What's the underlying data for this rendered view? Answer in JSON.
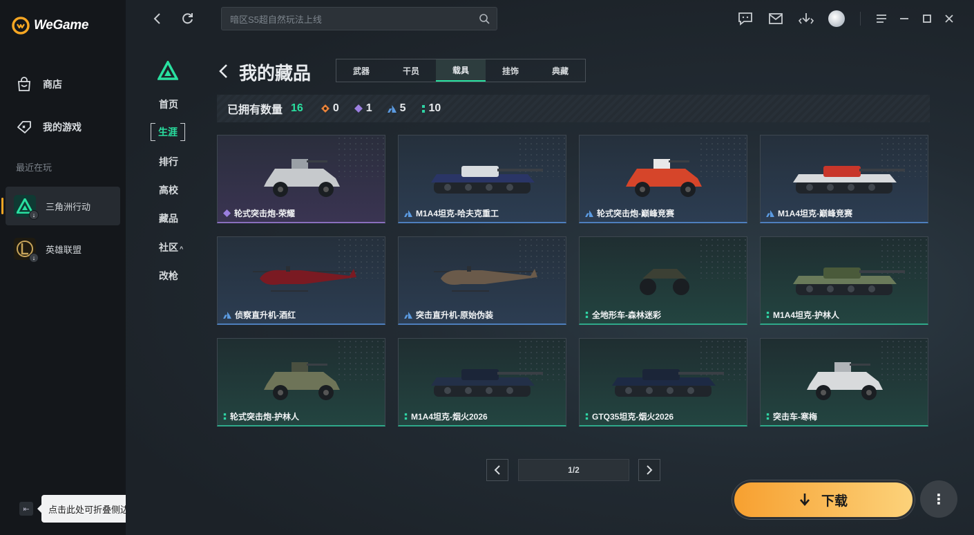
{
  "app": {
    "name": "WeGame"
  },
  "sidebar": {
    "items": [
      {
        "label": "商店",
        "icon": "shop-bag-icon"
      },
      {
        "label": "我的游戏",
        "icon": "gamepad-icon"
      }
    ],
    "recent_label": "最近在玩",
    "games": [
      {
        "label": "三角洲行动",
        "icon": "delta-force-icon",
        "active": true
      },
      {
        "label": "英雄联盟",
        "icon": "league-icon",
        "active": false
      }
    ],
    "collapse_tooltip": "点击此处可折叠侧边栏"
  },
  "topbar": {
    "search_placeholder": "暗区S5超自然玩法上线"
  },
  "subnav": {
    "items": [
      "首页",
      "生涯",
      "排行",
      "高校",
      "藏品",
      "社区",
      "改枪"
    ],
    "active": "生涯"
  },
  "page": {
    "title": "我的藏品",
    "tabs": [
      "武器",
      "干员",
      "载具",
      "挂饰",
      "典藏"
    ],
    "active_tab": "载具"
  },
  "stats": {
    "owned_label": "已拥有数量",
    "owned_total": "16",
    "counts": [
      {
        "rarity": "orange",
        "color": "#e8823a",
        "value": "0"
      },
      {
        "rarity": "purple",
        "color": "#9b7fe0",
        "value": "1"
      },
      {
        "rarity": "blue",
        "color": "#5b9ae0",
        "value": "5"
      },
      {
        "rarity": "green",
        "color": "#2fd4a4",
        "value": "10"
      }
    ]
  },
  "items": [
    {
      "name": "轮式突击炮-荣耀",
      "rarity": "purple"
    },
    {
      "name": "M1A4坦克-哈夫克重工",
      "rarity": "blue"
    },
    {
      "name": "轮式突击炮-巅峰竞赛",
      "rarity": "blue"
    },
    {
      "name": "M1A4坦克-巅峰竞赛",
      "rarity": "blue"
    },
    {
      "name": "侦察直升机-酒红",
      "rarity": "blue"
    },
    {
      "name": "突击直升机-原始伪装",
      "rarity": "blue"
    },
    {
      "name": "全地形车-森林迷彩",
      "rarity": "green"
    },
    {
      "name": "M1A4坦克-护林人",
      "rarity": "green"
    },
    {
      "name": "轮式突击炮-护林人",
      "rarity": "green"
    },
    {
      "name": "M1A4坦克-烟火2026",
      "rarity": "green"
    },
    {
      "name": "GTQ35坦克-烟火2026",
      "rarity": "green"
    },
    {
      "name": "突击车-寒梅",
      "rarity": "green"
    }
  ],
  "pager": {
    "label": "1/2"
  },
  "download": {
    "label": "下载"
  },
  "colors": {
    "accent_green": "#29e0a0",
    "download_orange": "#f7a030"
  }
}
